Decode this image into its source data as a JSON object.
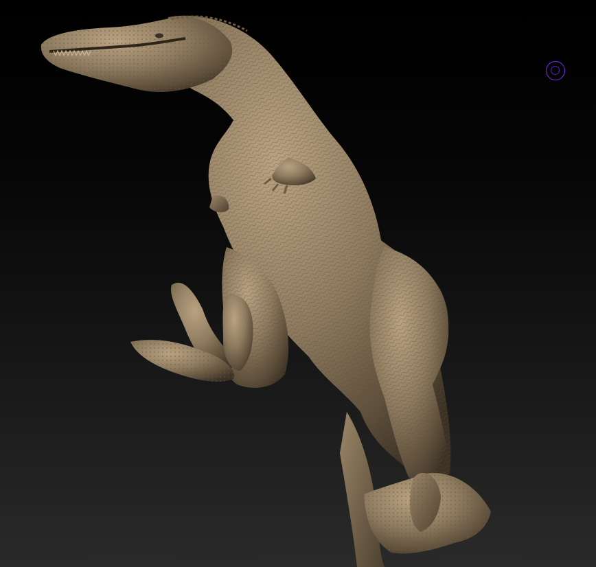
{
  "app": {
    "view": "3d-viewport",
    "subject": "sculpted-dinosaur-model"
  },
  "colors": {
    "background_top": "#000000",
    "background_bottom": "#2a2a2a",
    "model_clay": "#8f7c60",
    "model_shadow": "#4a3d2c",
    "cursor_outer": "#7a2cff",
    "cursor_inner": "#5a1fc4"
  },
  "icons": {
    "cursor": "brush-cursor-icon"
  }
}
